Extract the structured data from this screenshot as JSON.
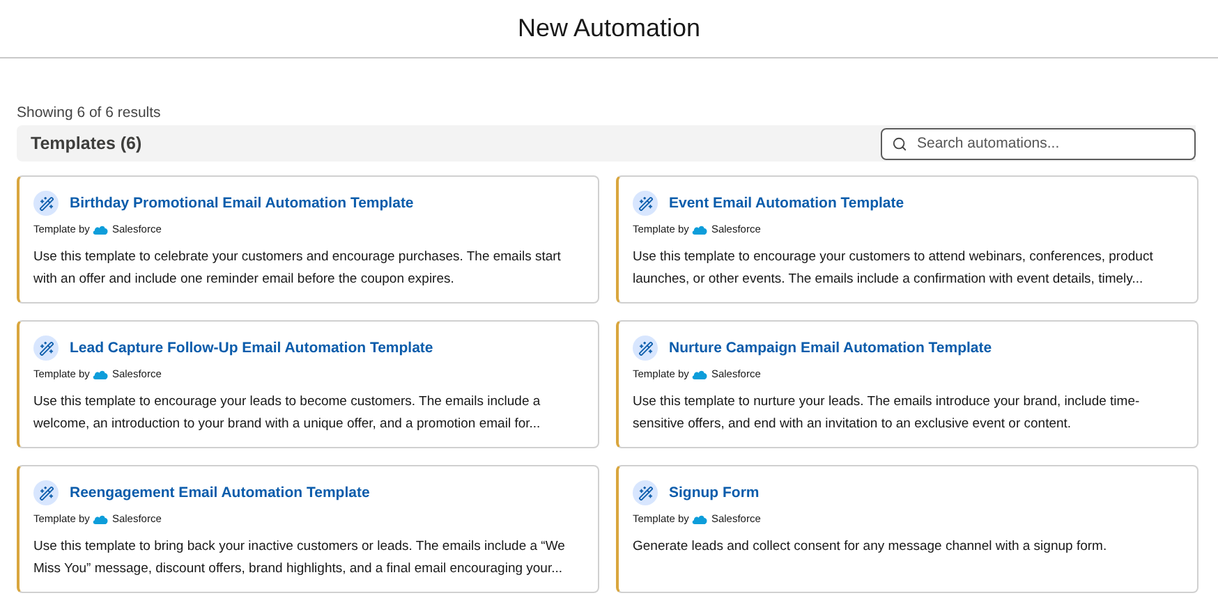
{
  "header": {
    "title": "New Automation"
  },
  "results_count": "Showing 6 of 6 results",
  "section": {
    "title": "Templates (6)"
  },
  "search": {
    "placeholder": "Search automations..."
  },
  "templates": [
    {
      "title": "Birthday Promotional Email Automation Template",
      "byline": "Template by",
      "publisher": "Salesforce",
      "description": "Use this template to celebrate your customers and encourage purchases. The emails start with an offer and include one reminder email before the coupon expires."
    },
    {
      "title": "Event Email Automation Template",
      "byline": "Template by",
      "publisher": "Salesforce",
      "description": "Use this template to encourage your customers to attend webinars, conferences, product launches, or other events. The emails include a confirmation with event details, timely..."
    },
    {
      "title": "Lead Capture Follow-Up Email Automation Template",
      "byline": "Template by",
      "publisher": "Salesforce",
      "description": "Use this template to encourage your leads to become customers. The emails include a welcome, an introduction to your brand with a unique offer, and a promotion email for..."
    },
    {
      "title": "Nurture Campaign Email Automation Template",
      "byline": "Template by",
      "publisher": "Salesforce",
      "description": "Use this template to nurture your leads. The emails introduce your brand, include time-sensitive offers, and end with an invitation to an exclusive event or content."
    },
    {
      "title": "Reengagement Email Automation Template",
      "byline": "Template by",
      "publisher": "Salesforce",
      "description": "Use this template to bring back your inactive customers or leads. The emails include a “We Miss You” message, discount offers, brand highlights, and a final email encouraging your..."
    },
    {
      "title": "Signup Form",
      "byline": "Template by",
      "publisher": "Salesforce",
      "description": "Generate leads and collect consent for any message channel with a signup form."
    }
  ]
}
